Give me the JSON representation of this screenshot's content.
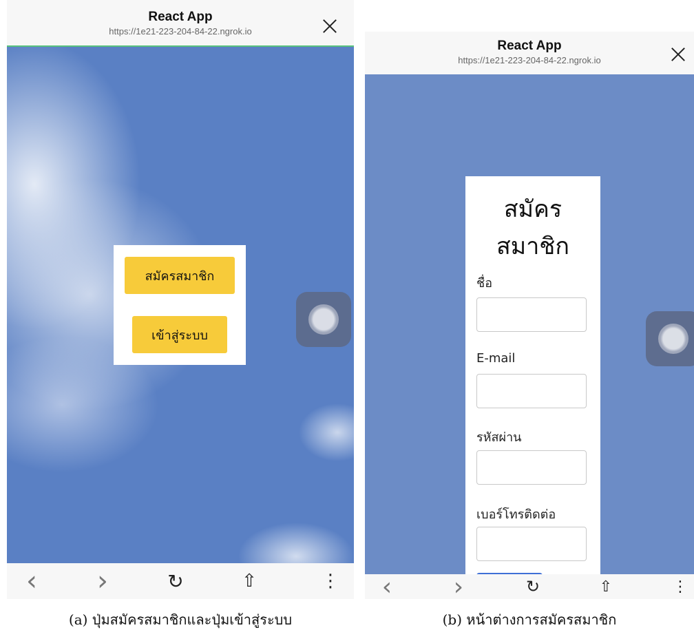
{
  "browser": {
    "app_title": "React App",
    "url": "https://1e21-223-204-84-22.ngrok.io",
    "nav": {
      "back_glyph": "‹",
      "forward_glyph": "›",
      "reload_glyph": "↻",
      "share_glyph": "⇧",
      "more_glyph": "⋮"
    },
    "icons": [
      "close-icon",
      "back-icon",
      "forward-icon",
      "reload-icon",
      "share-icon",
      "more-icon",
      "assistive-touch-icon"
    ]
  },
  "panel_a": {
    "buttons": {
      "register": "สมัครสมาชิก",
      "login": "เข้าสู่ระบบ"
    },
    "caption": "(a) ปุ่มสมัครสมาชิกและปุ่มเข้าสู่ระบบ"
  },
  "panel_b": {
    "form": {
      "title_line1": "สมัคร",
      "title_line2": "สมาชิก",
      "fields": [
        {
          "label": "ชื่อ",
          "value": ""
        },
        {
          "label": "E-mail",
          "value": ""
        },
        {
          "label": "รหัสผ่าน",
          "value": ""
        },
        {
          "label": "เบอร์โทรติดต่อ",
          "value": ""
        }
      ]
    },
    "caption": "(b) หน้าต่างการสมัครสมาชิก"
  },
  "colors": {
    "button_yellow": "#f7cb3a",
    "page_blue_b": "#6c8cc6",
    "sky_blue_a": "#5a80c4",
    "submit_blue": "#3e6fd6"
  }
}
